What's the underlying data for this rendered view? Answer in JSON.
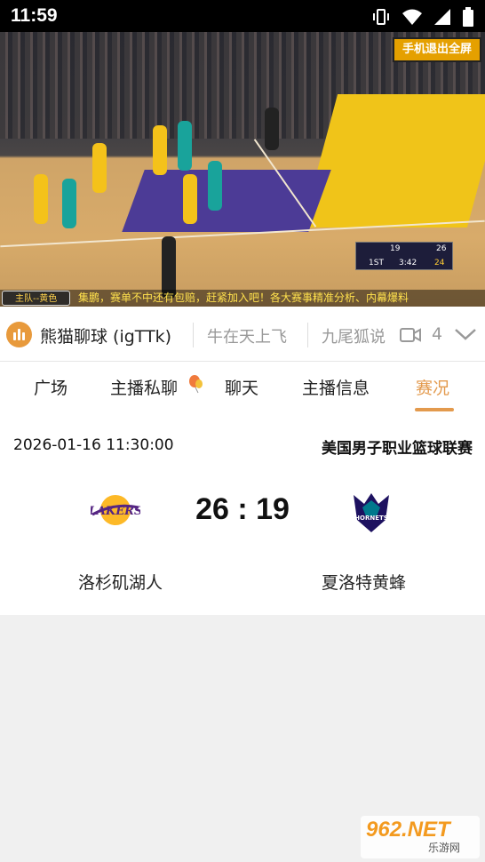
{
  "status_bar": {
    "time": "11:59"
  },
  "video": {
    "corner_logo": "手机退出全屏",
    "team_tag": "主队--黄色",
    "marquee": "集鹏，赛单不中还有包赔，赶紧加入吧！各大赛事精准分析、内幕爆料",
    "scoreboard": {
      "away_score": "19",
      "home_score": "26",
      "period": "1ST",
      "clock": "3:42",
      "shot": "24"
    }
  },
  "room_bar": {
    "streamer_name": "熊猫聊球 (igTTk)",
    "tab2": "牛在天上飞",
    "tab3": "九尾狐说",
    "viewer_count": "4"
  },
  "tabs": [
    {
      "label": "广场"
    },
    {
      "label": "主播私聊"
    },
    {
      "label": "聊天"
    },
    {
      "label": "主播信息"
    },
    {
      "label": "赛况"
    }
  ],
  "match": {
    "datetime": "2026-01-16 11:30:00",
    "league": "美国男子职业篮球联赛",
    "score": "26 : 19",
    "home_team": "洛杉矶湖人",
    "away_team": "夏洛特黄蜂",
    "home_logo_text": "LAKERS",
    "away_logo_text": "HORNETS"
  },
  "watermark": {
    "big": "962.NET",
    "small": "乐游网"
  },
  "colors": {
    "accent": "#e39a4d",
    "lakers_purple": "#552583",
    "lakers_gold": "#fdb927",
    "hornets_purple": "#1d1160"
  }
}
